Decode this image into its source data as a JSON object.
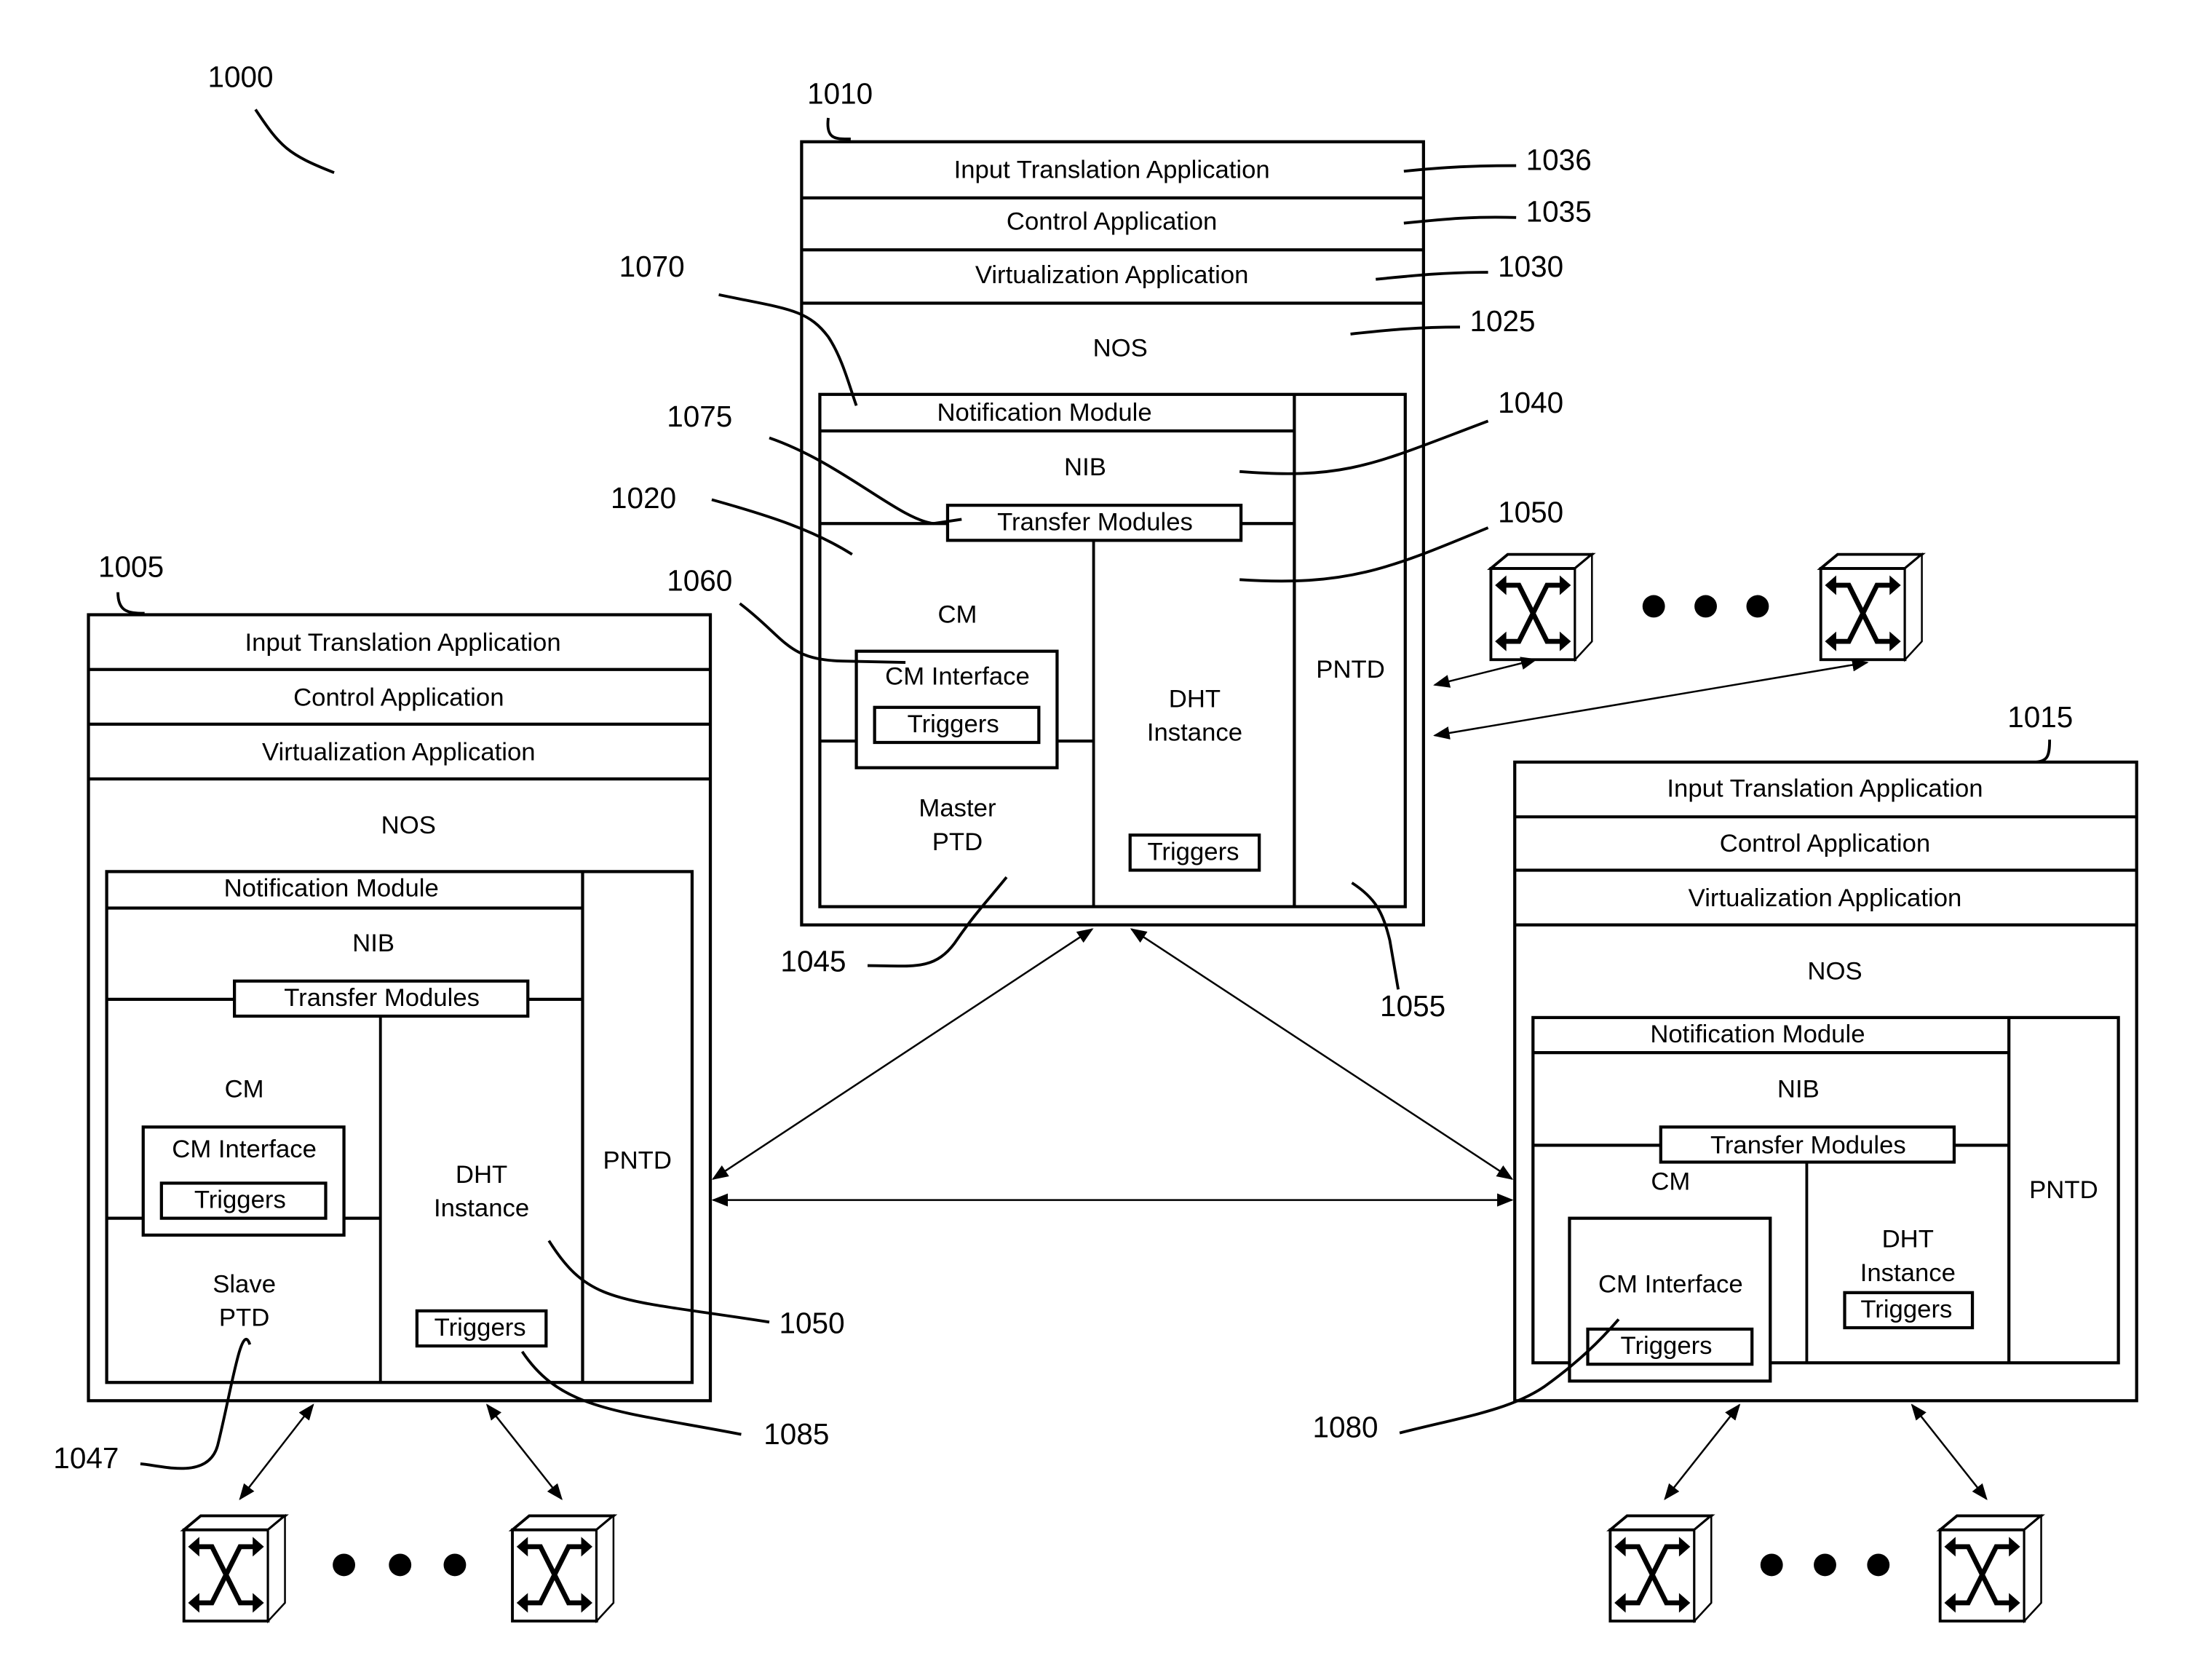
{
  "figure": {
    "ref": "1000",
    "description": "Network control system with three controller instances and managed switching elements"
  },
  "controllers": [
    {
      "id": "center",
      "ref": "1010",
      "layers": [
        "Input Translation Application",
        "Control Application",
        "Virtualization Application"
      ],
      "nos_label": "NOS",
      "notification_module": "Notification Module",
      "nib": "NIB",
      "transfer_modules": "Transfer Modules",
      "cm": "CM",
      "cm_interface": "CM Interface",
      "cm_triggers": "Triggers",
      "ptd": [
        "Master",
        "PTD"
      ],
      "dht": [
        "DHT",
        "Instance"
      ],
      "dht_triggers": "Triggers",
      "pntd": "PNTD"
    },
    {
      "id": "left",
      "ref": "1005",
      "layers": [
        "Input Translation Application",
        "Control Application",
        "Virtualization Application"
      ],
      "nos_label": "NOS",
      "notification_module": "Notification Module",
      "nib": "NIB",
      "transfer_modules": "Transfer Modules",
      "cm": "CM",
      "cm_interface": "CM Interface",
      "cm_triggers": "Triggers",
      "ptd": [
        "Slave",
        "PTD"
      ],
      "dht": [
        "DHT",
        "Instance"
      ],
      "dht_triggers": "Triggers",
      "pntd": "PNTD"
    },
    {
      "id": "right",
      "ref": "1015",
      "layers": [
        "Input Translation Application",
        "Control Application",
        "Virtualization Application"
      ],
      "nos_label": "NOS",
      "notification_module": "Notification Module",
      "nib": "NIB",
      "transfer_modules": "Transfer Modules",
      "cm": "CM",
      "cm_interface": "CM Interface",
      "cm_triggers": "Triggers",
      "dht": [
        "DHT",
        "Instance"
      ],
      "dht_triggers": "Triggers",
      "pntd": "PNTD"
    }
  ],
  "reference_labels": {
    "r1036": "1036",
    "r1035": "1035",
    "r1030": "1030",
    "r1025": "1025",
    "r1070": "1070",
    "r1075": "1075",
    "r1020": "1020",
    "r1060": "1060",
    "r1040": "1040",
    "r1050a": "1050",
    "r1045": "1045",
    "r1055": "1055",
    "r1050b": "1050",
    "r1085": "1085",
    "r1047": "1047",
    "r1080": "1080"
  },
  "switch_groups": [
    {
      "name": "center-switches",
      "count_shown": 2,
      "ellipsis": "•••"
    },
    {
      "name": "left-switches",
      "count_shown": 2,
      "ellipsis": "•••"
    },
    {
      "name": "right-switches",
      "count_shown": 2,
      "ellipsis": "•••"
    }
  ]
}
